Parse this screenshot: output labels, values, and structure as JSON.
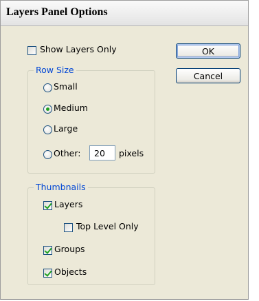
{
  "dialog": {
    "title": "Layers Panel Options",
    "show_layers_only": {
      "label": "Show Layers Only",
      "checked": false
    },
    "buttons": {
      "ok": "OK",
      "cancel": "Cancel"
    },
    "row_size": {
      "legend": "Row Size",
      "options": [
        {
          "label": "Small",
          "selected": false
        },
        {
          "label": "Medium",
          "selected": true
        },
        {
          "label": "Large",
          "selected": false
        },
        {
          "label": "Other:",
          "selected": false
        }
      ],
      "other_value": "20",
      "other_unit": "pixels"
    },
    "thumbnails": {
      "legend": "Thumbnails",
      "layers": {
        "label": "Layers",
        "checked": true
      },
      "top_level_only": {
        "label": "Top Level Only",
        "checked": false
      },
      "groups": {
        "label": "Groups",
        "checked": true
      },
      "objects": {
        "label": "Objects",
        "checked": true
      }
    },
    "colors": {
      "face": "#ece9d8",
      "accent_blue": "#0046d5",
      "check_green": "#21a121"
    }
  }
}
